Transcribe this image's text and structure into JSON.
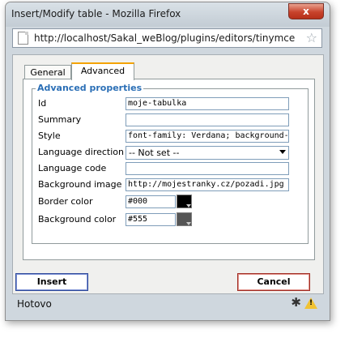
{
  "window": {
    "title": "Insert/Modify table - Mozilla Firefox",
    "close_label": "x"
  },
  "urlbar": {
    "url": "http://localhost/Sakal_weBlog/plugins/editors/tinymce/jscr",
    "star_icon": "star-icon"
  },
  "tabs": [
    {
      "label": "General"
    },
    {
      "label": "Advanced",
      "active": true
    }
  ],
  "fieldset": {
    "legend": "Advanced properties",
    "rows": [
      {
        "label": "Id",
        "value": "moje-tabulka"
      },
      {
        "label": "Summary",
        "value": ""
      },
      {
        "label": "Style",
        "value": "font-family: Verdana; background-i"
      },
      {
        "label": "Language direction",
        "value": "-- Not set --"
      },
      {
        "label": "Language code",
        "value": ""
      },
      {
        "label": "Background image",
        "value": "http://mojestranky.cz/pozadi.jpg"
      },
      {
        "label": "Border color",
        "value": "#000",
        "swatch": "#000000"
      },
      {
        "label": "Background color",
        "value": "#555",
        "swatch": "#555555"
      }
    ]
  },
  "buttons": {
    "insert": "Insert",
    "cancel": "Cancel"
  },
  "status": {
    "text": "Hotovo"
  },
  "colors": {
    "accent": "#2b6fb6",
    "tab_highlight": "#f4a300"
  }
}
